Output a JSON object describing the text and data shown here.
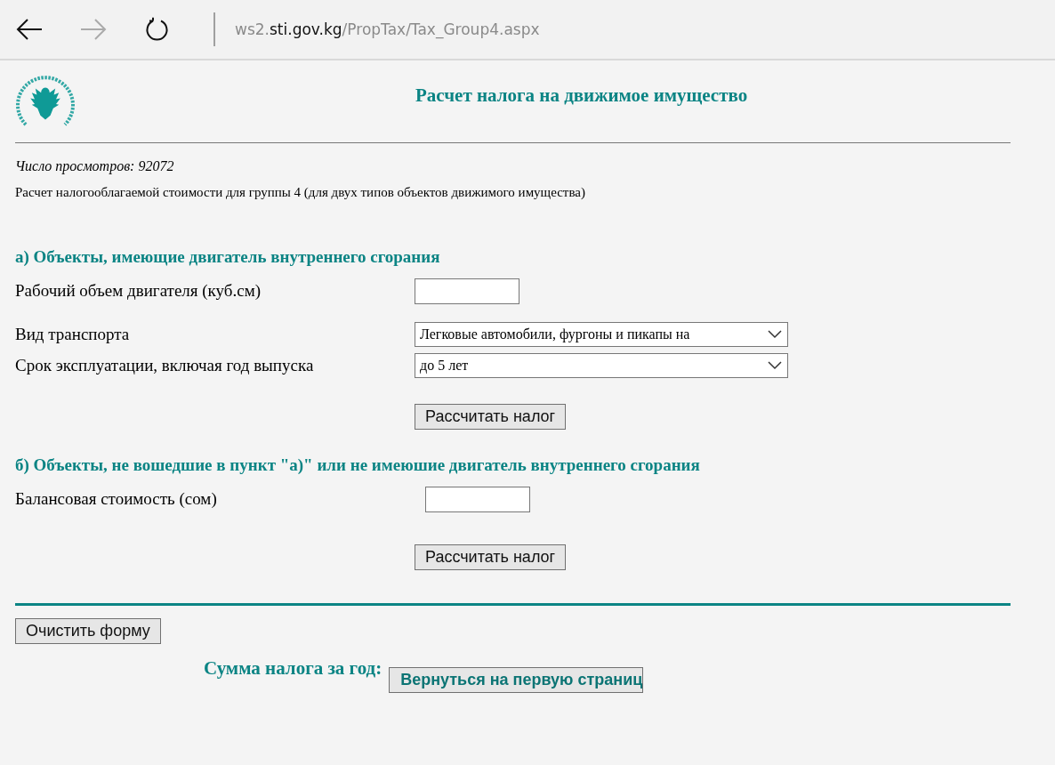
{
  "browser": {
    "back": {
      "disabled": false
    },
    "forward": {
      "disabled": true
    },
    "url_parts": [
      {
        "text": "ws2.",
        "emphasis": false
      },
      {
        "text": "sti.gov.kg",
        "emphasis": true
      },
      {
        "text": "/PropTax/Tax_Group4.aspx",
        "emphasis": false
      }
    ]
  },
  "title": "Расчет налога на движимое имущество",
  "views": "Число просмотров: 92072",
  "description": "Расчет налогооблагаемой стоимости для группы 4 (для двух типов объектов движимого имущества)",
  "sections": [
    {
      "heading": "а) Объекты, имеющие двигатель внутреннего сгорания",
      "fields": [
        {
          "kind": "input",
          "label": "Рабочий объем двигателя (куб.см)"
        },
        {
          "kind": "select",
          "label": "Вид транспорта",
          "value": "Легковые автомобили, фургоны и пикапы на"
        },
        {
          "kind": "select",
          "label": "Срок эксплуатации, включая год выпуска",
          "value": "до 5 лет"
        }
      ],
      "button": "Рассчитать налог"
    },
    {
      "heading": "б) Объекты, не вошедшие в пункт \"а)\" или не имеюшие двигатель внутреннего сгорания",
      "fields": [
        {
          "kind": "input",
          "label": "Балансовая стоимость (сом)"
        }
      ],
      "button": "Рассчитать налог"
    }
  ],
  "clear_button": "Очистить форму",
  "sum_label": "Сумма налога за год:",
  "return_button": "Вернуться на первую страниц"
}
